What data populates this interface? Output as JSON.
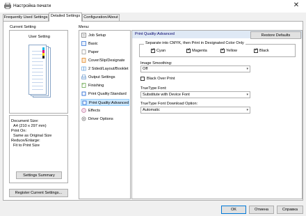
{
  "window": {
    "title": "Настройка печати",
    "close_glyph": "✕"
  },
  "tabs": [
    {
      "label": "Frequently Used Settings",
      "active": false
    },
    {
      "label": "Detailed Settings",
      "active": true
    },
    {
      "label": "Configuration/About",
      "active": false
    }
  ],
  "left": {
    "current_setting_label": "Current Setting",
    "user_setting": "User Setting",
    "info": {
      "document_size_label": "Document Size:",
      "document_size_value": "A4 (210 x 297 mm)",
      "print_on_label": "Print On:",
      "print_on_value": "Same as Original Size",
      "reduce_enlarge_label": "Reduce/Enlarge:",
      "reduce_enlarge_value": "Fit to Print Size"
    },
    "settings_summary_button": "Settings Summary",
    "register_button": "Register Current Settings..."
  },
  "menu": {
    "label": "Menu:",
    "items": [
      {
        "label": "Job Setup",
        "icon": "job-setup-icon",
        "color": "#7a7a7a"
      },
      {
        "label": "Basic",
        "icon": "basic-icon",
        "color": "#3c78d8"
      },
      {
        "label": "Paper",
        "icon": "paper-icon",
        "color": "#9a9a9a"
      },
      {
        "label": "Cover/Slip/Designate",
        "icon": "cover-icon",
        "color": "#e08a2c"
      },
      {
        "label": "2 Sided/Layout/Booklet",
        "icon": "layout-icon",
        "color": "#4a90d9"
      },
      {
        "label": "Output Settings",
        "icon": "output-icon",
        "color": "#5b8fc9"
      },
      {
        "label": "Finishing",
        "icon": "finishing-icon",
        "color": "#6aa84f"
      },
      {
        "label": "Print Quality:Standard",
        "icon": "quality-standard-icon",
        "color": "#3c78d8"
      },
      {
        "label": "Print Quality:Advanced",
        "icon": "quality-advanced-icon",
        "color": "#3c78d8",
        "selected": true
      },
      {
        "label": "Effects",
        "icon": "effects-icon",
        "color": "#c27ba0"
      },
      {
        "label": "Driver Options",
        "icon": "driver-options-icon",
        "color": "#7a7a7a"
      }
    ]
  },
  "settings": {
    "header_title": "Print Quality:Advanced",
    "restore_defaults": "Restore Defaults",
    "cmyk_group_title": "Separate into CMYK, then Print in Designated Color Only",
    "colors": [
      {
        "label": "Cyan",
        "checked": true
      },
      {
        "label": "Magenta",
        "checked": true
      },
      {
        "label": "Yellow",
        "checked": true
      },
      {
        "label": "Black",
        "checked": true
      }
    ],
    "image_smoothing_label": "Image Smoothing:",
    "image_smoothing_value": "Off",
    "black_over_print_label": "Black Over Print",
    "black_over_print_checked": false,
    "truetype_font_label": "TrueType Font:",
    "truetype_font_value": "Substitute with Device Font",
    "truetype_download_label": "TrueType Font Download Option:",
    "truetype_download_value": "Automatic",
    "check_glyph": "✓",
    "chevron_glyph": "▾"
  },
  "footer": {
    "ok": "OK",
    "cancel": "Отмена",
    "help": "Справка"
  },
  "colors": {
    "selection_bg": "#cce8ff",
    "selection_border": "#99d1ff",
    "header_bg": "#dfe9f5",
    "default_button_border": "#0078d7"
  }
}
